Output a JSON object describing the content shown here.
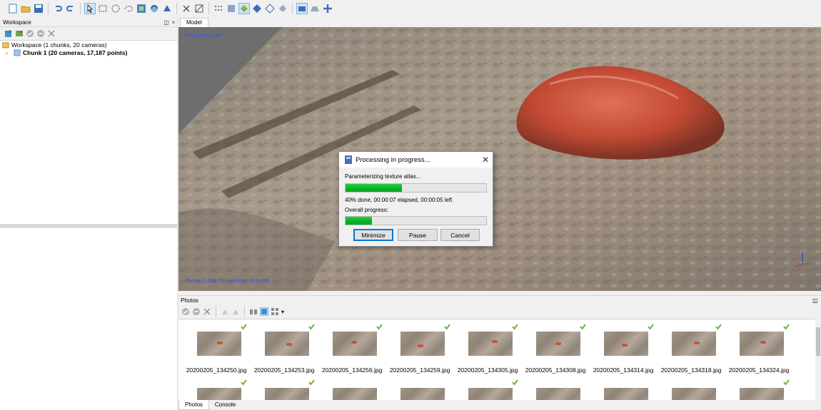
{
  "toolbar": {
    "icons": [
      "new-doc-icon",
      "open-folder-icon",
      "save-icon",
      "undo-icon",
      "redo-icon",
      "select-pointer-icon",
      "rect-select-icon",
      "circle-select-icon",
      "free-select-icon",
      "resize-region-icon",
      "rotate-region-icon",
      "navigation-icon",
      "delete-icon",
      "crop-icon",
      "point-cloud-icon",
      "dense-cloud-icon",
      "shaded-model-icon",
      "solid-model-icon",
      "wireframe-icon",
      "textured-icon",
      "show-cameras-icon",
      "show-region-icon",
      "move-object-icon"
    ]
  },
  "workspace": {
    "title": "Workspace",
    "root_label": "Workspace (1 chunks, 20 cameras)",
    "chunk_label": "Chunk 1 (20 cameras, 17,187 points)"
  },
  "model": {
    "tab_label": "Model",
    "perspective_label": "Perspective 30°",
    "stats_label": "Faces: 1,838,794 vertices: 919,795"
  },
  "dialog": {
    "title": "Processing in progress...",
    "task": "Parameterizing texture atlas...",
    "task_progress": 0.4,
    "status": "40% done, 00:00:07 elapsed, 00:00:05 left",
    "overall_label": "Overall progress:",
    "overall_progress": 0.19,
    "minimize_label": "Minimize",
    "pause_label": "Pause",
    "cancel_label": "Cancel"
  },
  "photos": {
    "title": "Photos",
    "files": [
      "20200205_134250.jpg",
      "20200205_134253.jpg",
      "20200205_134256.jpg",
      "20200205_134259.jpg",
      "20200205_134305.jpg",
      "20200205_134308.jpg",
      "20200205_134314.jpg",
      "20200205_134318.jpg",
      "20200205_134324.jpg"
    ],
    "row2_checked": [
      true,
      true,
      false,
      false,
      true,
      false,
      false,
      false,
      true
    ]
  },
  "bottom_tabs": [
    "Photos",
    "Console"
  ],
  "colors": {
    "accent_green": "#06b025",
    "viewport_label": "#3050ff",
    "check_green": "#6cb33f"
  }
}
